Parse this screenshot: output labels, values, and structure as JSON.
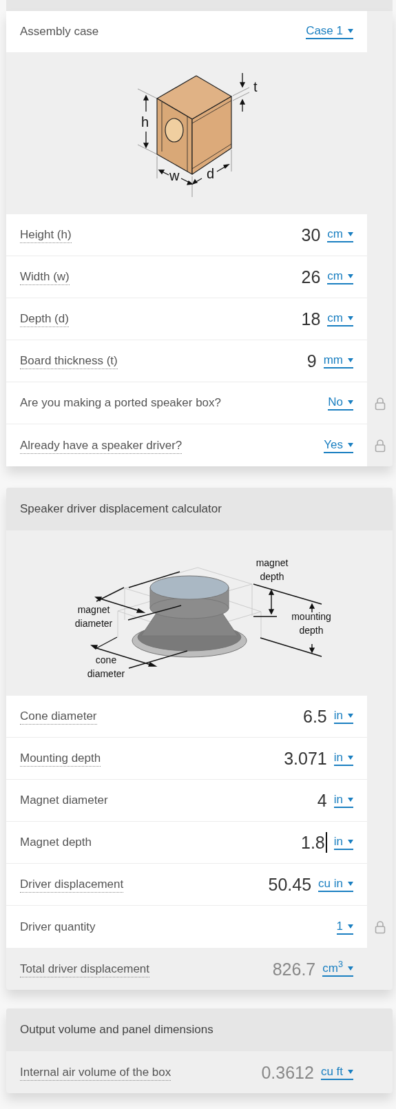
{
  "sections": [
    {
      "items": [
        {
          "kind": "select",
          "label": "Assembly case",
          "tooltip": false,
          "unit": "Case 1",
          "locked": false
        },
        {
          "kind": "box_figure",
          "labels": [
            "h",
            "w",
            "d",
            "t"
          ]
        },
        {
          "kind": "input",
          "label": "Height (h)",
          "tooltip": true,
          "value": "30",
          "unit": "cm",
          "focused": false,
          "locked": false
        },
        {
          "kind": "input",
          "label": "Width (w)",
          "tooltip": true,
          "value": "26",
          "unit": "cm",
          "focused": false,
          "locked": false
        },
        {
          "kind": "input",
          "label": "Depth (d)",
          "tooltip": true,
          "value": "18",
          "unit": "cm",
          "focused": false,
          "locked": false
        },
        {
          "kind": "input",
          "label": "Board thickness (t)",
          "tooltip": true,
          "value": "9",
          "unit": "mm",
          "focused": false,
          "locked": false
        },
        {
          "kind": "select",
          "label": "Are you making a ported speaker box?",
          "tooltip": false,
          "unit": "No",
          "locked": true
        },
        {
          "kind": "select",
          "label": "Already have a speaker driver?",
          "tooltip": true,
          "unit": "Yes",
          "locked": true
        }
      ]
    },
    {
      "title": "Speaker driver displacement calculator",
      "items": [
        {
          "kind": "driver_figure",
          "labels": [
            "magnet depth",
            "magnet diameter",
            "mounting depth",
            "cone diameter"
          ]
        },
        {
          "kind": "input",
          "label": "Cone diameter",
          "tooltip": true,
          "value": "6.5",
          "unit": "in",
          "focused": false,
          "locked": false
        },
        {
          "kind": "input",
          "label": "Mounting depth",
          "tooltip": true,
          "value": "3.071",
          "unit": "in",
          "focused": false,
          "locked": false
        },
        {
          "kind": "input",
          "label": "Magnet diameter",
          "tooltip": false,
          "value": "4",
          "unit": "in",
          "focused": false,
          "locked": false
        },
        {
          "kind": "input",
          "label": "Magnet depth",
          "tooltip": false,
          "value": "1.8",
          "unit": "in",
          "focused": true,
          "locked": false
        },
        {
          "kind": "input",
          "label": "Driver displacement",
          "tooltip": true,
          "value": "50.45",
          "unit": "cu in",
          "focused": false,
          "locked": false
        },
        {
          "kind": "select",
          "label": "Driver quantity",
          "tooltip": false,
          "unit": "1",
          "locked": true
        },
        {
          "kind": "result",
          "label": "Total driver displacement",
          "tooltip": true,
          "value": "826.7",
          "unit": "cm$^{3}$",
          "locked": false
        }
      ]
    },
    {
      "title": "Output volume and panel dimensions",
      "items": [
        {
          "kind": "result",
          "label": "Internal air volume of the box",
          "tooltip": true,
          "value": "0.3612",
          "unit": "cu ft",
          "locked": false
        }
      ]
    }
  ]
}
